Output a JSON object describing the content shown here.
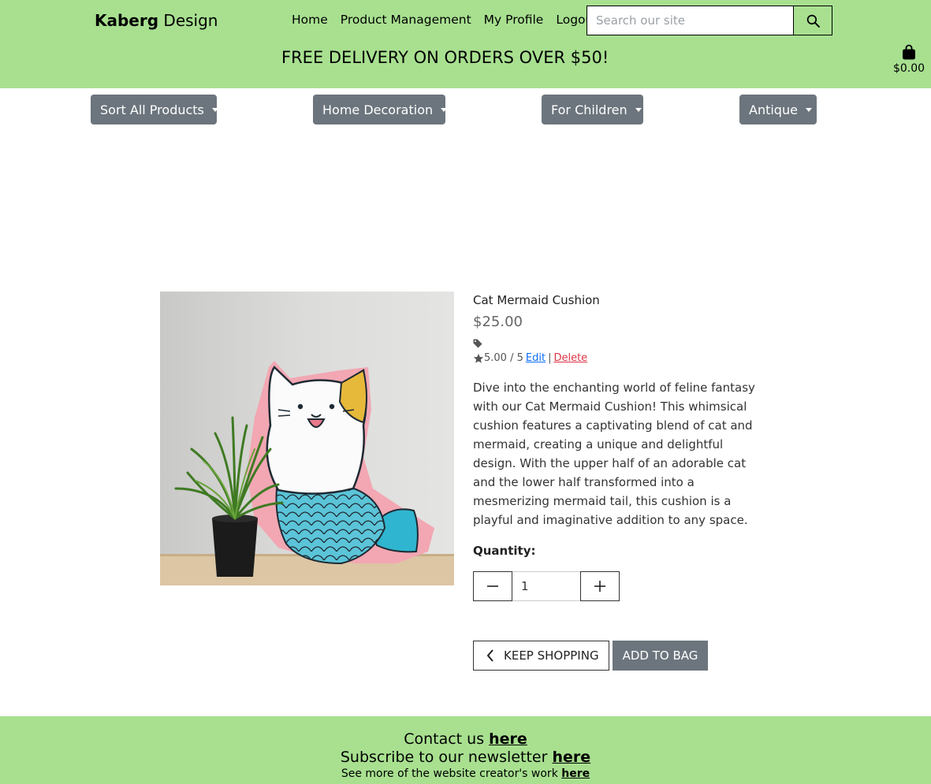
{
  "brand": {
    "bold": "Kaberg",
    "rest": "Design"
  },
  "nav": [
    "Home",
    "Product Management",
    "My Profile",
    "Logout"
  ],
  "search": {
    "placeholder": "Search our site"
  },
  "banner": "FREE DELIVERY ON ORDERS OVER $50!",
  "cart": {
    "total": "$0.00"
  },
  "menus": [
    "Sort All Products",
    "Home Decoration",
    "For Children",
    "Antique"
  ],
  "product": {
    "name": "Cat Mermaid Cushion",
    "price": "$25.00",
    "rating": "5.00 / 5",
    "edit_label": "Edit",
    "separator": "|",
    "delete_label": "Delete",
    "description": "Dive into the enchanting world of feline fantasy with our Cat Mermaid Cushion! This whimsical cushion features a captivating blend of cat and mermaid, creating a unique and delightful design. With the upper half of an adorable cat and the lower half transformed into a mesmerizing mermaid tail, this cushion is a playful and imaginative addition to any space.",
    "quantity_label": "Quantity:",
    "quantity_value": "1"
  },
  "actions": {
    "keep_shopping": "KEEP SHOPPING",
    "add_to_bag": "ADD TO BAG"
  },
  "footer": {
    "contact_text": "Contact us",
    "subscribe_text": "Subscribe to our newsletter",
    "creator_text": "See more of the website creator's work",
    "link_label": "here"
  },
  "colors": {
    "header_bg": "#a8e090",
    "button_grey": "#6c757d",
    "edit_link": "#0d6efd",
    "delete_link": "#dc3545"
  }
}
